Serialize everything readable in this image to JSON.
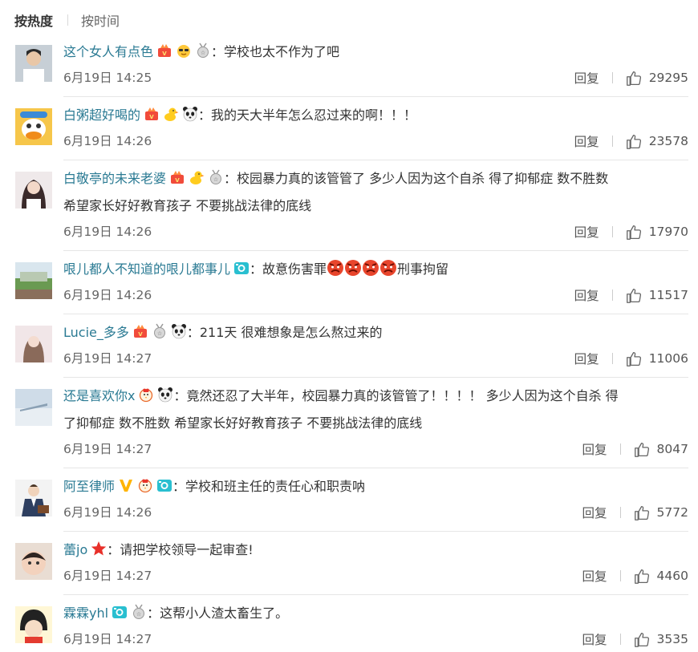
{
  "tabs": {
    "hot": "按热度",
    "time": "按时间"
  },
  "comments": [
    {
      "user": "这个女人有点色",
      "text": "：学校也太不作为了吧",
      "time": "6月19日 14:25",
      "reply": "回复",
      "likes": "29295"
    },
    {
      "user": "白粥超好喝的",
      "text": "：我的天大半年怎么忍过来的啊！！！",
      "time": "6月19日 14:26",
      "reply": "回复",
      "likes": "23578"
    },
    {
      "user": "白敬亭的未来老婆",
      "text": "：校园暴力真的该管管了 多少人因为这个自杀 得了抑郁症 数不胜数",
      "text2": "希望家长好好教育孩子 不要挑战法律的底线",
      "time": "6月19日 14:26",
      "reply": "回复",
      "likes": "17970"
    },
    {
      "user": "哏儿都人不知道的哏儿都事儿",
      "text": "：故意伤害罪",
      "text_after": "刑事拘留",
      "time": "6月19日 14:26",
      "reply": "回复",
      "likes": "11517"
    },
    {
      "user": "Lucie_多多",
      "text": "：211天 很难想象是怎么熬过来的",
      "time": "6月19日 14:27",
      "reply": "回复",
      "likes": "11006"
    },
    {
      "user": "还是喜欢你x",
      "text": "：竟然还忍了大半年，校园暴力真的该管管了！！！！ 多少人因为这个自杀 得",
      "text2": "了抑郁症 数不胜数 希望家长好好教育孩子 不要挑战法律的底线",
      "time": "6月19日 14:27",
      "reply": "回复",
      "likes": "8047"
    },
    {
      "user": "阿至律师",
      "text": "：学校和班主任的责任心和职责呐",
      "time": "6月19日 14:26",
      "reply": "回复",
      "likes": "5772"
    },
    {
      "user": "蕾jo",
      "text": "：请把学校领导一起审查!",
      "time": "6月19日 14:27",
      "reply": "回复",
      "likes": "4460"
    },
    {
      "user": "霖霖yhl",
      "text": "：这帮小人渣太畜生了。",
      "time": "6月19日 14:27",
      "reply": "回复",
      "likes": "3535"
    }
  ],
  "colors": {
    "username": "#2a7a93",
    "divider": "#e6e6e6",
    "angry": "#e8452c"
  }
}
